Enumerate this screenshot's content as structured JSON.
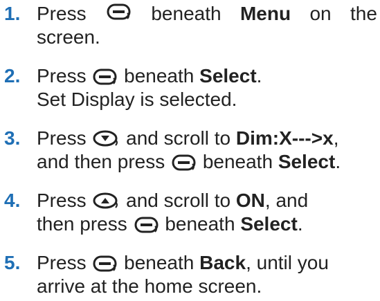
{
  "steps": [
    {
      "number": "1.",
      "line1": {
        "press": "Press",
        "after_icon": "beneath",
        "bold": "Menu",
        "on": "on",
        "the": "the"
      },
      "line2": "screen.",
      "icon": "softkey-button-icon"
    },
    {
      "number": "2.",
      "press": "Press",
      "after_icon": "beneath",
      "bold": "Select",
      "end": ".",
      "line2": "Set Display is selected.",
      "icon": "softkey-button-icon"
    },
    {
      "number": "3.",
      "press": "Press",
      "after_icon": "and scroll to",
      "bold": "Dim:X--->x",
      "end": ",",
      "line2_pre": "and then press",
      "line2_after_icon": "beneath",
      "line2_bold": "Select",
      "line2_end": ".",
      "icon": "down-arrow-button-icon"
    },
    {
      "number": "4.",
      "press": "Press",
      "after_icon": "and scroll to",
      "bold": "ON",
      "end": ", and",
      "line2_pre": "then press",
      "line2_after_icon": "beneath",
      "line2_bold": "Select",
      "line2_end": ".",
      "icon": "up-arrow-button-icon"
    },
    {
      "number": "5.",
      "press": "Press",
      "after_icon": "beneath",
      "bold": "Back",
      "end": ", until you",
      "line2": "arrive at the home screen.",
      "icon": "softkey-button-icon"
    }
  ],
  "colors": {
    "step_number": "#1f6fb5",
    "text": "#222222"
  }
}
